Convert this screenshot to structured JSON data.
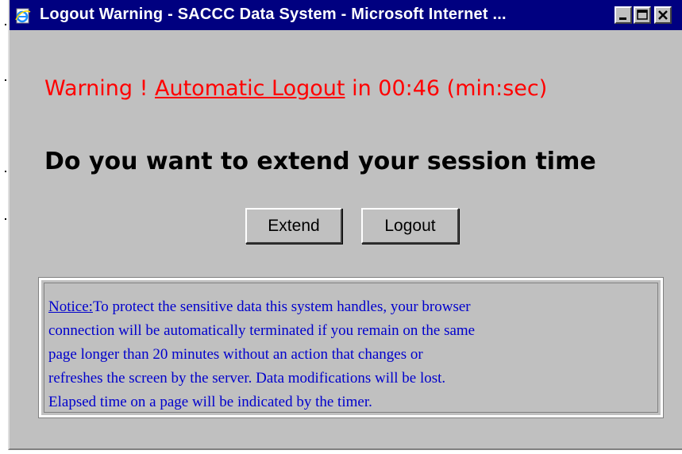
{
  "window": {
    "title": "Logout Warning - SACCC Data System - Microsoft Internet ...",
    "icon": "ie-page-icon",
    "buttons": [
      "minimize-icon",
      "maximize-icon",
      "close-icon"
    ]
  },
  "warning": {
    "prefix": "Warning ! ",
    "link_text": "Automatic Logout",
    "suffix": " in 00:46  (min:sec)",
    "color": "#ff0000"
  },
  "question": "Do you want to extend your session time",
  "actions": {
    "extend_label": "Extend",
    "logout_label": "Logout"
  },
  "notice": {
    "label": "Notice:",
    "lines": [
      "To protect the sensitive data  this system handles, your browser",
      "connection will be automatically  terminated if you remain on the same",
      "page longer than 20 minutes  without an action that  changes or",
      "refreshes the screen by the server. Data modifications will be  lost.",
      "Elapsed time on a page will be indicated by the  timer."
    ],
    "color": "#0000cc"
  },
  "colors": {
    "titlebar": "#000080",
    "dialog_background": "#c0c0c0"
  }
}
